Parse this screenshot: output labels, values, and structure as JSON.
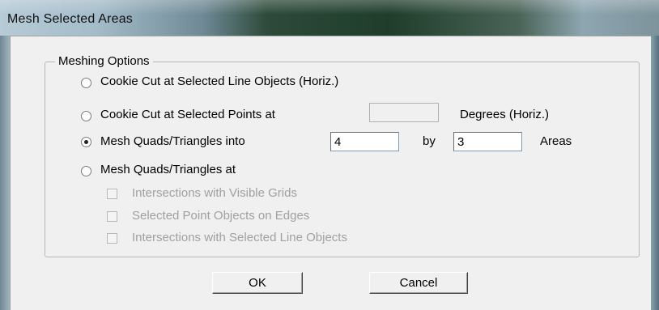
{
  "window": {
    "title": "Mesh Selected Areas"
  },
  "group": {
    "legend": "Meshing Options"
  },
  "options": {
    "cookie_lines": {
      "label": "Cookie Cut at Selected Line Objects (Horiz.)",
      "selected": false
    },
    "cookie_points": {
      "label": "Cookie Cut at Selected Points at",
      "degrees_value": "",
      "degrees_label": "Degrees (Horiz.)",
      "selected": false
    },
    "mesh_into": {
      "label": "Mesh Quads/Triangles into",
      "value_1": "4",
      "by_label": "by",
      "value_2": "3",
      "areas_label": "Areas",
      "selected": true
    },
    "mesh_at": {
      "label": "Mesh Quads/Triangles at",
      "selected": false
    }
  },
  "checks": {
    "visible_grids": {
      "label": "Intersections with Visible Grids",
      "checked": false,
      "enabled": false
    },
    "point_edges": {
      "label": "Selected Point Objects on Edges",
      "checked": false,
      "enabled": false
    },
    "line_objects": {
      "label": "Intersections with Selected Line Objects",
      "checked": false,
      "enabled": false
    }
  },
  "buttons": {
    "ok": "OK",
    "cancel": "Cancel"
  }
}
